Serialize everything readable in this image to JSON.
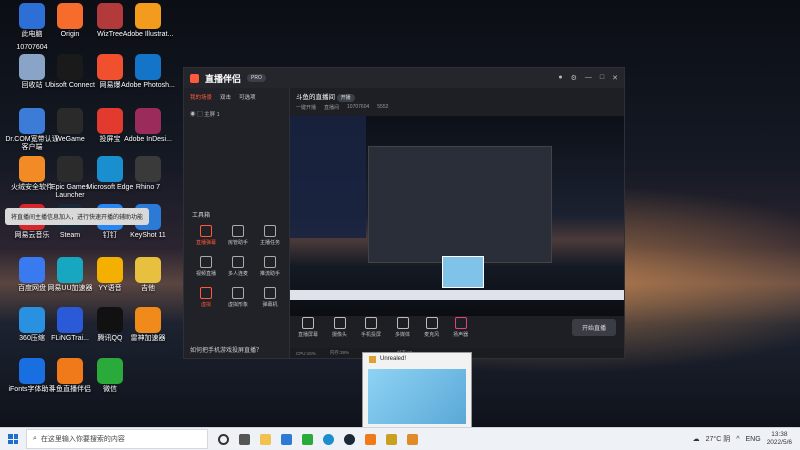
{
  "desktop_icons": [
    {
      "label": "此电脑",
      "color": "#2d6fd6"
    },
    {
      "label": "Origin",
      "color": "#f56c2d"
    },
    {
      "label": "WizTree",
      "color": "#b33a3a"
    },
    {
      "label": "Adobe Illustrat...",
      "color": "#f29b1d"
    },
    {
      "label": "回收站",
      "color": "#8aa4c8"
    },
    {
      "label": "Ubisoft Connect",
      "color": "#1a1a1a"
    },
    {
      "label": "网易爆",
      "color": "#f0502d"
    },
    {
      "label": "Adobe Photosh...",
      "color": "#1475c8"
    },
    {
      "label": "Dr.COM宽带认证客户端",
      "color": "#3c7bd8"
    },
    {
      "label": "WeGame",
      "color": "#2a2a2a"
    },
    {
      "label": "投屏宝",
      "color": "#e33a2f"
    },
    {
      "label": "Adobe InDesi...",
      "color": "#9a2b5a"
    },
    {
      "label": "火绒安全软件",
      "color": "#f28b26"
    },
    {
      "label": "Epic Games Launcher",
      "color": "#2b2b2b"
    },
    {
      "label": "Microsoft Edge",
      "color": "#1a8fd0"
    },
    {
      "label": "Rhino 7",
      "color": "#3a3a3a"
    },
    {
      "label": "网易云音乐",
      "color": "#d6282b"
    },
    {
      "label": "Steam",
      "color": "#1b2838"
    },
    {
      "label": "钉钉",
      "color": "#2a86f0"
    },
    {
      "label": "KeyShot 11",
      "color": "#2a7ad6"
    },
    {
      "label": "百度网盘",
      "color": "#3a7af0"
    },
    {
      "label": "网易UU加速器",
      "color": "#18a7c0"
    },
    {
      "label": "YY语音",
      "color": "#f4b000"
    },
    {
      "label": "吉他",
      "color": "#e8c040"
    },
    {
      "label": "360压缩",
      "color": "#2a90e0"
    },
    {
      "label": "FLiNGTrai...",
      "color": "#2a5ad8"
    },
    {
      "label": "腾讯QQ",
      "color": "#111"
    },
    {
      "label": "雷神加速器",
      "color": "#f08a1a"
    },
    {
      "label": "iFonts字体助手",
      "color": "#1a6fe0"
    },
    {
      "label": "斗鱼直播伴侣",
      "color": "#f07a1a"
    },
    {
      "label": "微信",
      "color": "#2aaa3a"
    }
  ],
  "top_left": {
    "id": "10707604"
  },
  "app": {
    "brand": "直播伴侣",
    "badge": "PRO",
    "left_tabs": [
      "我的场景",
      "双击",
      "可选项"
    ],
    "scene": "主屏 1",
    "tools_title": "工具箱",
    "tools": [
      {
        "label": "直播弹幕",
        "red": true
      },
      {
        "label": "房管助手",
        "red": false
      },
      {
        "label": "主播任务",
        "red": false
      },
      {
        "label": "视频直播",
        "red": false
      },
      {
        "label": "多人连麦",
        "red": false
      },
      {
        "label": "推流助手",
        "red": false
      },
      {
        "label": "虚拟",
        "red": true
      },
      {
        "label": "虚拟形象",
        "red": false
      },
      {
        "label": "弹幕机",
        "red": false
      }
    ],
    "tooltip": "将直播间主播信息加入，进行快速开播的辅助功能",
    "hint": "如何把手机游戏投屏直播？",
    "room_title": "斗鱼的直播间",
    "room_tag": "开播",
    "room_meta": [
      "一键开播",
      "直播间",
      "10707604",
      "5552"
    ],
    "bottom_buttons": [
      "直播屏幕",
      "摄像头",
      "手机投屏",
      "多媒体",
      "麦克风",
      "扬声器"
    ],
    "start_button": "开始直播",
    "status": [
      "CPU:15%",
      "内存:38%",
      "GPU:27%",
      "帧率:60"
    ]
  },
  "popup": {
    "title": "Unrealed!"
  },
  "taskbar": {
    "search_placeholder": "在这里输入你要搜索的内容",
    "weather": "27°C 阴",
    "lang": "ENG",
    "time": "13:38",
    "date": "2022/5/6"
  }
}
